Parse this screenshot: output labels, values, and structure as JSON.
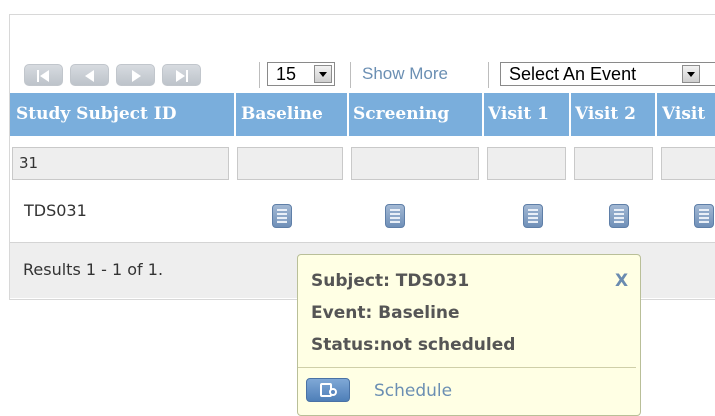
{
  "toolbar": {
    "page_size": "15",
    "show_more": "Show More",
    "event_select": "Select An Event"
  },
  "table": {
    "columns": [
      "Study Subject ID",
      "Baseline",
      "Screening",
      "Visit 1",
      "Visit 2",
      "Visit"
    ],
    "filter_value": "31",
    "row": {
      "subject_id": "TDS031"
    },
    "results": "Results 1 - 1 of 1."
  },
  "popup": {
    "subject": "Subject: TDS031",
    "event": "Event: Baseline",
    "status": "Status:not scheduled",
    "close": "X",
    "action": "Schedule"
  },
  "icons": {
    "first": "first-page-icon",
    "prev": "prev-page-icon",
    "next": "next-page-icon",
    "last": "last-page-icon",
    "event": "event-status-icon",
    "schedule": "schedule-icon"
  },
  "colors": {
    "header_bg": "#7aaedc",
    "link": "#6b8fb3",
    "popup_bg": "#ffffe4"
  }
}
